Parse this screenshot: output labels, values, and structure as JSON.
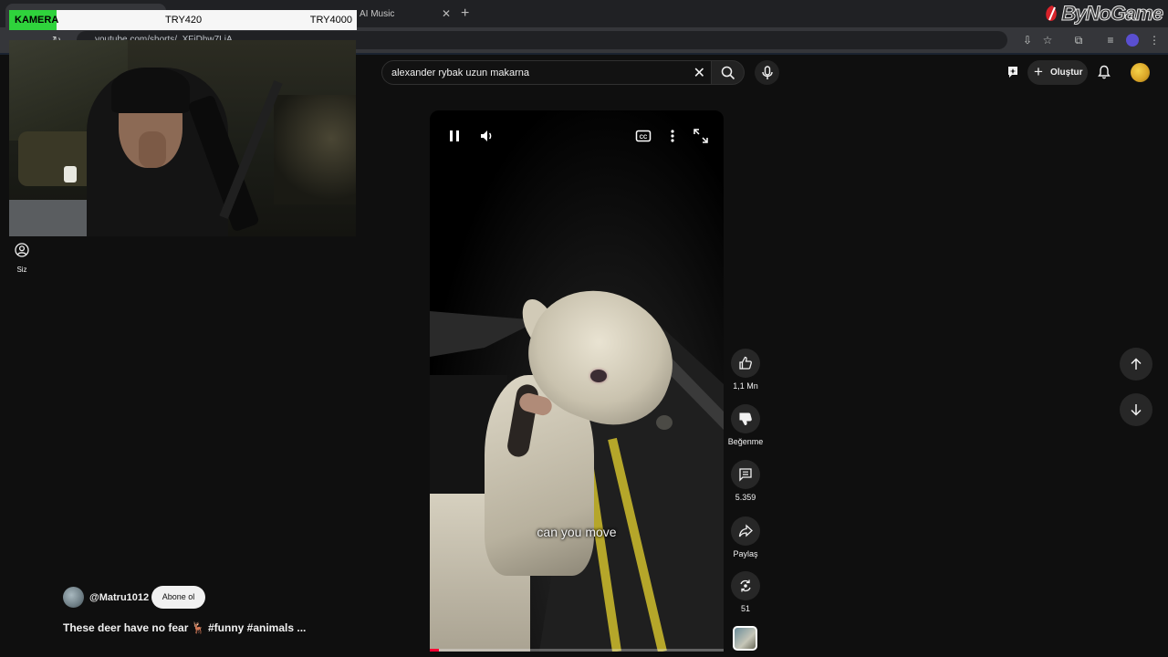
{
  "browser": {
    "tabs": [
      {
        "title": ""
      },
      {
        "title": "AI Music"
      }
    ],
    "url": "youtube.com/shorts/_XFiDhw7LiA",
    "watermark": "ByNoGame"
  },
  "overlay": {
    "camera_label": "KAMERA",
    "goal_1": "TRY420",
    "goal_2": "TRY4000"
  },
  "youtube": {
    "left_nav": {
      "you_label": "Siz"
    },
    "search": {
      "query": "alexander rybak uzun makarna"
    },
    "header": {
      "create_label": "Oluştur"
    },
    "player": {
      "caption": "can you move",
      "progress_fraction": 0.03
    },
    "actions": {
      "like_count": "1,1 Mn",
      "dislike_label": "Beğenme",
      "comment_count": "5.359",
      "share_label": "Paylaş",
      "remix_count": "51"
    },
    "channel": {
      "handle": "@Matru1012",
      "subscribe_label": "Abone ol"
    },
    "video_title": "These deer have no fear 🦌 #funny #animals ..."
  },
  "colors": {
    "background": "#0f0f0f",
    "overlay_green": "#2fd33c",
    "progress_red": "#ff0033"
  }
}
